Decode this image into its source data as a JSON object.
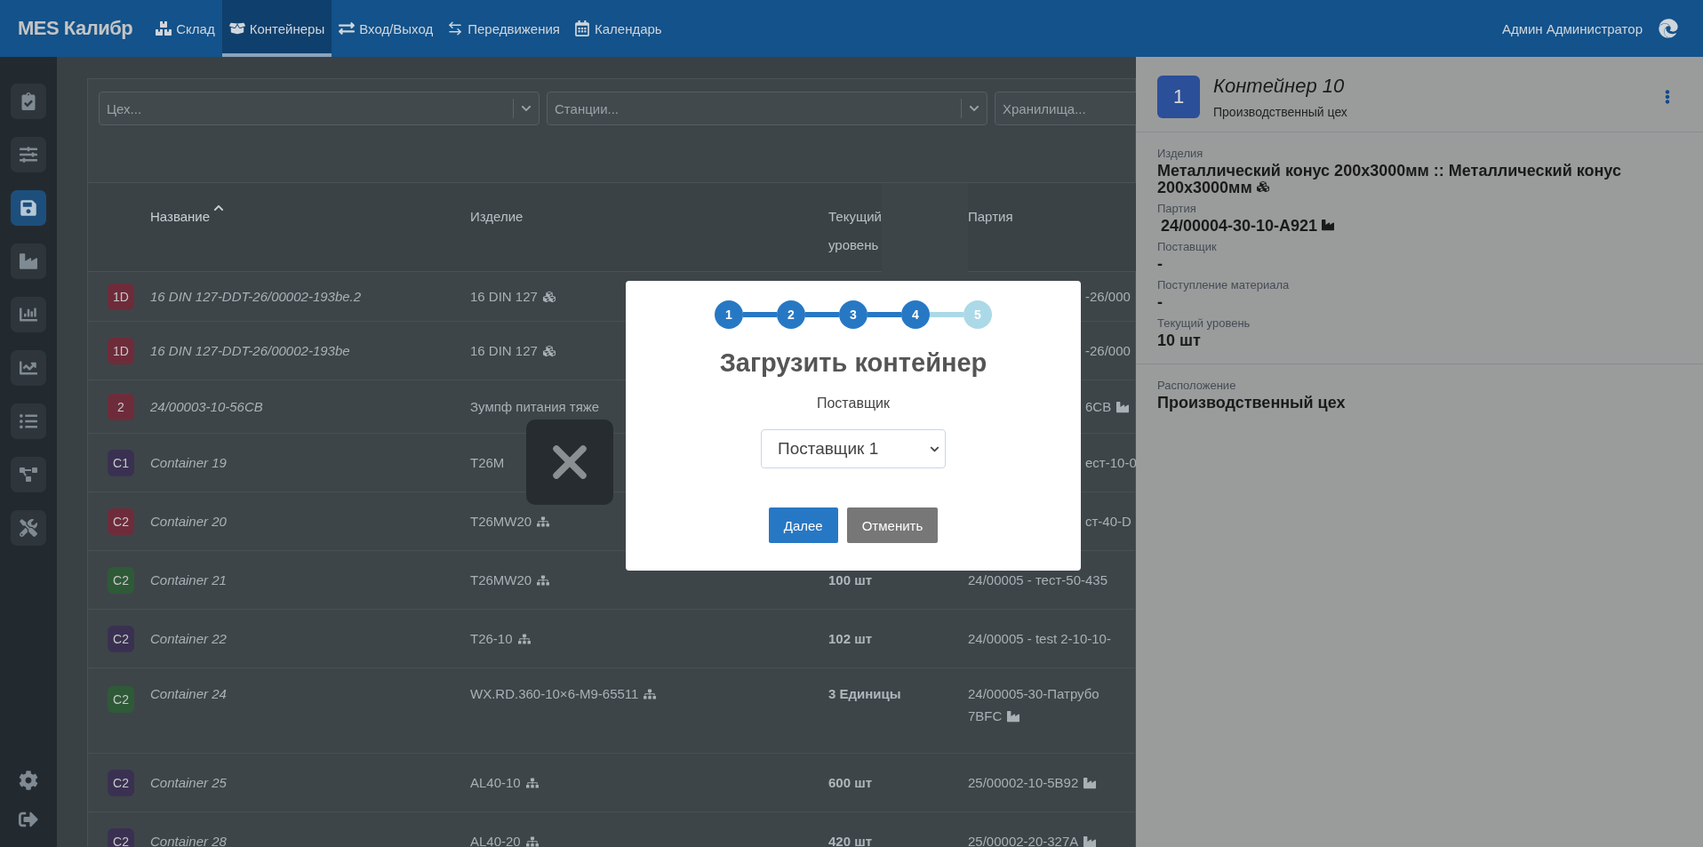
{
  "navbar": {
    "brand": "MES Калибр",
    "items": [
      {
        "label": "Склад",
        "selected": false
      },
      {
        "label": "Контейнеры",
        "selected": true
      },
      {
        "label": "Вход/Выход",
        "selected": false
      },
      {
        "label": "Передвижения",
        "selected": false
      },
      {
        "label": "Календарь",
        "selected": false
      }
    ],
    "user": "Админ Администратор"
  },
  "sidebar": {
    "items": [
      {
        "selected": false
      },
      {
        "selected": false
      },
      {
        "selected": true
      },
      {
        "selected": false
      },
      {
        "selected": false
      },
      {
        "selected": false
      },
      {
        "selected": false
      },
      {
        "selected": false
      },
      {
        "selected": false
      }
    ]
  },
  "filters": [
    {
      "placeholder": "Цех..."
    },
    {
      "placeholder": "Станции..."
    },
    {
      "placeholder": "Хранилища..."
    }
  ],
  "table": {
    "columns": [
      {
        "label": "Название",
        "sorted": true
      },
      {
        "label": "Изделие",
        "sorted": false
      },
      {
        "label": "Текущий уровень",
        "sorted": false
      },
      {
        "label": "Партия",
        "sorted": false
      }
    ],
    "rows": [
      {
        "badge": "1D",
        "color": "#6e2c3a",
        "name": "16 DIN 127-DDT-26/00002-193be.2",
        "product": {
          "text": "16 DIN 127",
          "kind": "brick"
        },
        "batch": {
          "text": "-26/000",
          "kind": "plain",
          "clipped": true
        }
      },
      {
        "badge": "1D",
        "color": "#6e2c3a",
        "name": "16 DIN 127-DDT-26/00002-193be",
        "product": {
          "text": "16 DIN 127",
          "kind": "brick"
        },
        "batch": {
          "text": "-26/000",
          "kind": "plain",
          "clipped": true
        }
      },
      {
        "badge": "2",
        "color": "#6e2c3a",
        "name": "24/00003-10-56CB",
        "product": {
          "text": "Зумпф питания тяже",
          "kind": "plain"
        },
        "batch": {
          "text": "6CB",
          "kind": "factory",
          "clipped": true
        }
      },
      {
        "badge": "C1",
        "color": "#3a3152",
        "name": "Container 19",
        "product": {
          "text": "T26M",
          "kind": "plain"
        },
        "batch": {
          "text": "ест-10-0",
          "kind": "plain",
          "clipped": true
        }
      },
      {
        "badge": "C2",
        "color": "#6e2c3a",
        "name": "Container 20",
        "product": {
          "text": "T26MW20",
          "kind": "boxes"
        },
        "batch": {
          "text": "ст-40-D",
          "kind": "plain",
          "clipped": true
        }
      },
      {
        "badge": "C2",
        "color": "#2f5a38",
        "name": "Container 21",
        "product": {
          "text": "T26MW20",
          "kind": "boxes"
        },
        "level": "100 шт",
        "batch": {
          "text": "24/00005 - тест-50-435",
          "kind": "plain",
          "clipped": false
        }
      },
      {
        "badge": "C2",
        "color": "#3a3152",
        "name": "Container 22",
        "product": {
          "text": "T26-10",
          "kind": "boxes"
        },
        "level": "102 шт",
        "batch": {
          "text": "24/00005 - test 2-10-10-",
          "kind": "plain",
          "clipped": false
        }
      },
      {
        "badge": "C2",
        "color": "#2f5a38",
        "name": "Container 24",
        "product": {
          "text": "WX.RD.360-10×6-M9-65511",
          "kind": "boxes"
        },
        "level": "3 Единицы",
        "batch": {
          "text": "24/00005-30-Патрубо",
          "kind": "plain",
          "clipped": false
        },
        "batch_line2": {
          "text": "7BFC",
          "kind": "factory"
        }
      },
      {
        "badge": "C2",
        "color": "#3a3152",
        "name": "Container 25",
        "product": {
          "text": "AL40-10",
          "kind": "boxes"
        },
        "level": "600 шт",
        "batch": {
          "text": "25/00002-10-5B92",
          "kind": "factory",
          "clipped": false
        }
      },
      {
        "badge": "C2",
        "color": "#3a3152",
        "name": "Container 28",
        "product": {
          "text": "AL40-20",
          "kind": "boxes"
        },
        "level": "420 шт",
        "batch": {
          "text": "25/00002-20-327A",
          "kind": "factory",
          "clipped": false
        }
      }
    ]
  },
  "panel": {
    "badge": "1",
    "title": "Контейнер 10",
    "subtitle": "Производственный цех",
    "fields": [
      {
        "label": "Изделия",
        "value": "Металлический конус 200х3000мм :: Металлический конус 200х3000мм",
        "kind": "brick"
      },
      {
        "label": "Партия",
        "value": "24/00004-30-10-A921",
        "kind": "factory"
      },
      {
        "label": "Поставщик",
        "value": "-",
        "kind": "plain"
      },
      {
        "label": "Поступление материала",
        "value": "-",
        "kind": "plain"
      },
      {
        "label": "Текущий уровень",
        "value": "10 шт",
        "kind": "plain"
      }
    ],
    "location": {
      "label": "Расположение",
      "value": "Производственный цех"
    }
  },
  "modal": {
    "steps": [
      {
        "label": "1",
        "done": true
      },
      {
        "label": "2",
        "done": true
      },
      {
        "label": "3",
        "done": true
      },
      {
        "label": "4",
        "done": true
      },
      {
        "label": "5",
        "done": false
      }
    ],
    "title": "Загрузить контейнер",
    "field_label": "Поставщик",
    "select_value": "Поставщик 1",
    "buttons": [
      {
        "label": "Далее",
        "kind": "primary"
      },
      {
        "label": "Отменить",
        "kind": "secondary"
      }
    ]
  }
}
